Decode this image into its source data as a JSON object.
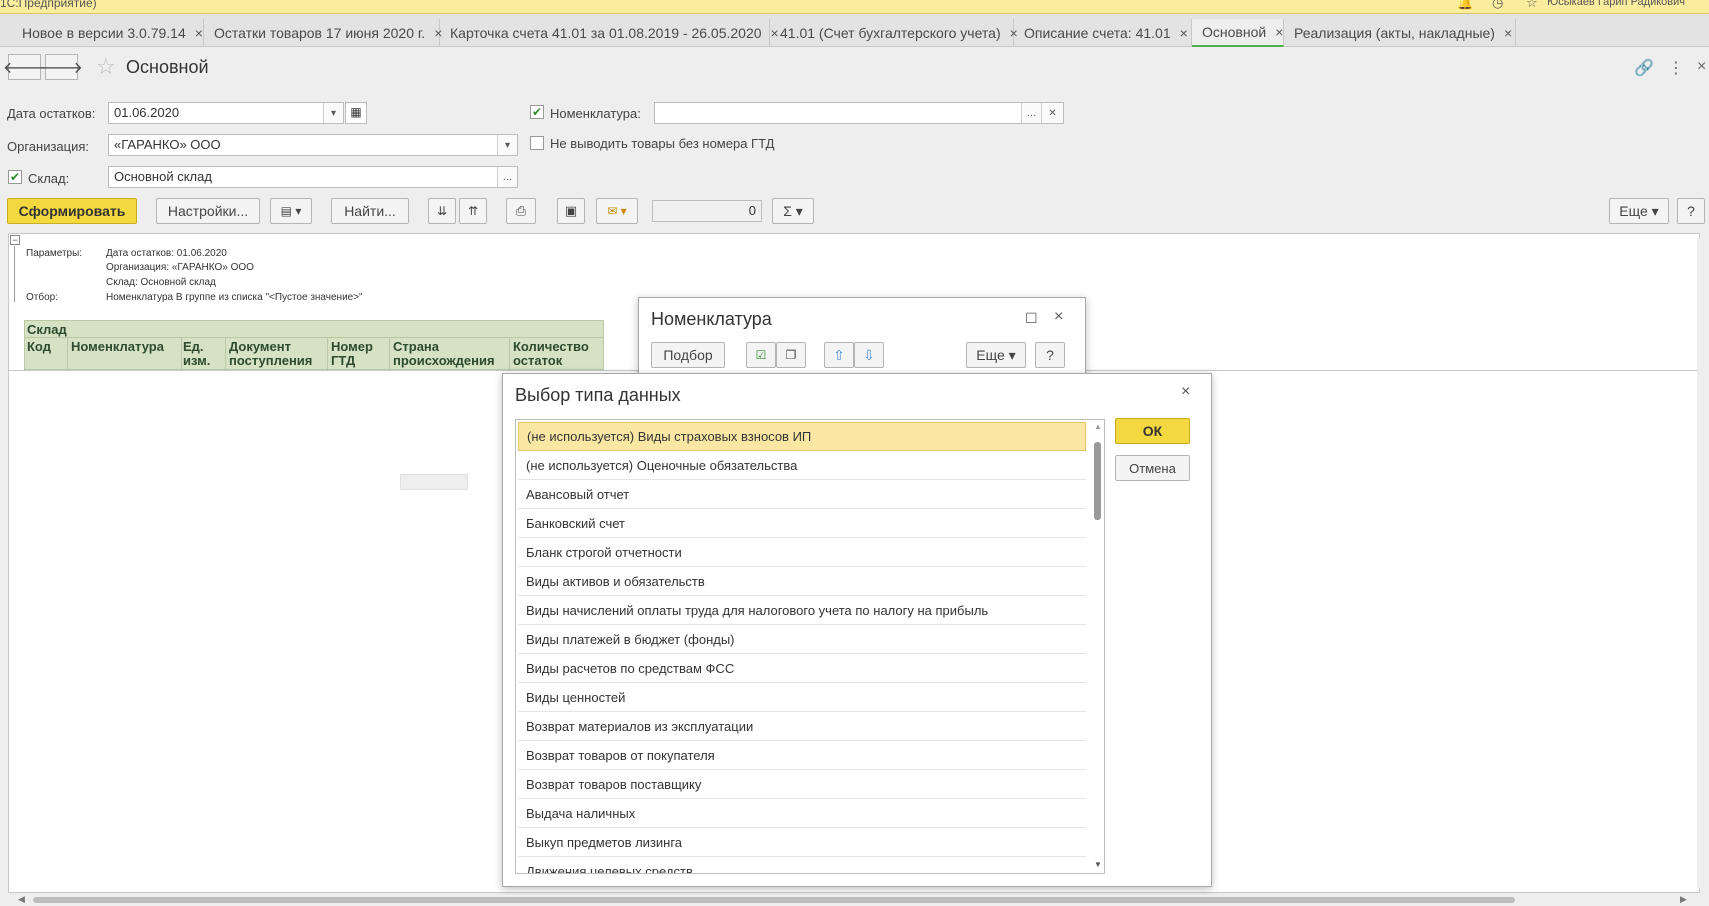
{
  "app": {
    "title": "1С:Предприятие)",
    "user": "Юсыкаев Гарип Радикович"
  },
  "tabs": [
    {
      "label": "Новое в версии 3.0.79.14",
      "close": "×"
    },
    {
      "label": "Остатки товаров 17 июня 2020 г.",
      "close": "×"
    },
    {
      "label": "Карточка счета 41.01 за 01.08.2019 - 26.05.2020",
      "close": "×"
    },
    {
      "label": "41.01 (Счет бухгалтерского учета)",
      "close": "×"
    },
    {
      "label": "Описание счета: 41.01",
      "close": "×"
    },
    {
      "label": "Основной",
      "close": "×"
    },
    {
      "label": "Реализация (акты, накладные)",
      "close": "×"
    }
  ],
  "form": {
    "title": "Основной",
    "date_label": "Дата остатков:",
    "date_value": "01.06.2020",
    "org_label": "Организация:",
    "org_value": "«ГАРАНКО» ООО",
    "warehouse_label": "Склад:",
    "warehouse_value": "Основной склад",
    "nomenclature_label": "Номенклатура:",
    "nomenclature_value": "",
    "no_gtd_label": "Не выводить товары без номера ГТД",
    "generate_button": "Сформировать",
    "settings_button": "Настройки...",
    "find_button": "Найти...",
    "counter_value": "0",
    "more_button": "Еще",
    "help_button": "?"
  },
  "report": {
    "params_label": "Параметры:",
    "params": [
      "Дата остатков: 01.06.2020",
      "Организация: «ГАРАНКО» ООО",
      "Склад: Основной склад"
    ],
    "filter_label": "Отбор:",
    "filter_value": "Номенклатура В группе из списка \"<Пустое значение>\"",
    "group_header": "Склад",
    "columns": [
      "Код",
      "Номенклатура",
      "Ед. изм.",
      "Документ поступления",
      "Номер ГТД",
      "Страна происхождения",
      "Количество остаток"
    ]
  },
  "nom_dialog": {
    "title": "Номенклатура",
    "select_button": "Подбор",
    "more_button": "Еще",
    "help_button": "?"
  },
  "type_dialog": {
    "title": "Выбор типа данных",
    "ok_button": "ОК",
    "cancel_button": "Отмена",
    "items": [
      "(не используется) Виды страховых взносов ИП",
      "(не используется) Оценочные обязательства",
      "Авансовый отчет",
      "Банковский счет",
      "Бланк строгой отчетности",
      "Виды активов и обязательств",
      "Виды начислений оплаты труда для налогового учета по налогу на прибыль",
      "Виды платежей в бюджет (фонды)",
      "Виды расчетов по средствам ФСС",
      "Виды ценностей",
      "Возврат материалов из эксплуатации",
      "Возврат товаров от покупателя",
      "Возврат товаров поставщику",
      "Выдача наличных",
      "Выкуп предметов лизинга",
      "Движения целевых средств"
    ]
  }
}
